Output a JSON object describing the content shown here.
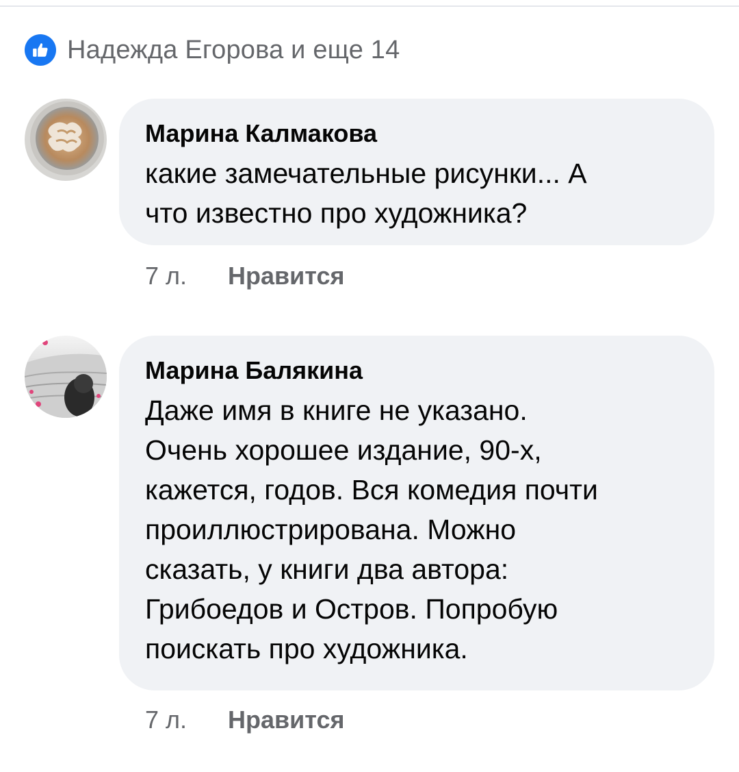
{
  "reactions": {
    "icon": "thumbs-up-icon",
    "accent": "#1877f2",
    "text": "Надежда Егорова и еще 14"
  },
  "comments": [
    {
      "author": "Марина Калмакова",
      "text": "какие замечательные рисунки... А\nчто известно про художника?",
      "time": "7 л.",
      "like_label": "Нравится"
    },
    {
      "author": "Марина Балякина",
      "text": "Даже имя в книге не указано.\nОчень хорошее издание, 90-х,\nкажется, годов. Вся комедия почти\nпроиллюстрирована. Можно\nсказать, у книги два автора:\nГрибоедов и Остров. Попробую\nпоискать про художника.",
      "time": "7 л.",
      "like_label": "Нравится"
    }
  ],
  "colors": {
    "bubble_bg": "#f0f2f5",
    "meta_text": "#65676b",
    "primary_text": "#050505"
  }
}
